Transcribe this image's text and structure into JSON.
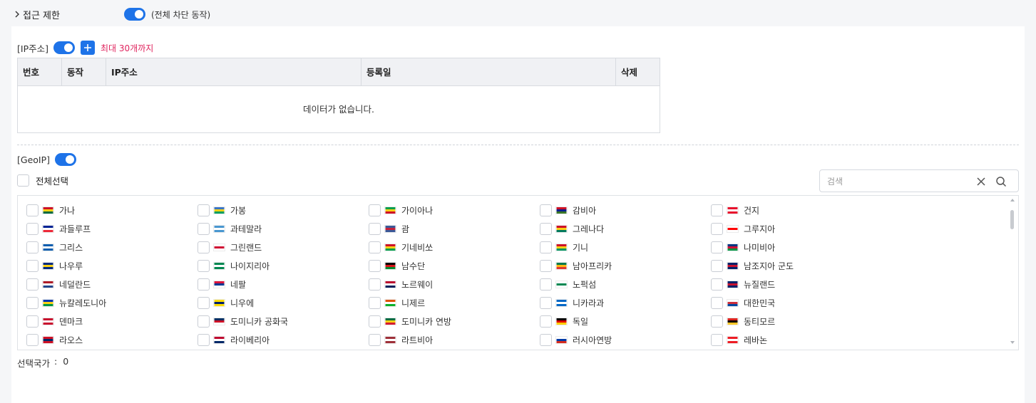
{
  "header": {
    "title": "접근 제한",
    "toggle_on": true,
    "note": "(전체 차단 동작)"
  },
  "ip_section": {
    "label": "[IP주소]",
    "toggle_on": true,
    "add_icon": "plus-icon",
    "limit_text": "최대 30개까지",
    "columns": [
      "번호",
      "동작",
      "IP주소",
      "등록일",
      "삭제"
    ],
    "empty_text": "데이터가 없습니다."
  },
  "geoip_section": {
    "label": "[GeoIP]",
    "toggle_on": true,
    "select_all_label": "전체선택",
    "search_placeholder": "검색",
    "countries": [
      [
        "가나",
        "가봉",
        "가이아나",
        "감비아",
        "건지"
      ],
      [
        "과들루프",
        "과테말라",
        "괌",
        "그레나다",
        "그루지아"
      ],
      [
        "그리스",
        "그린랜드",
        "기네비쏘",
        "기니",
        "나미비아"
      ],
      [
        "나우루",
        "나이지리아",
        "남수단",
        "남아프리카",
        "남조지아 군도"
      ],
      [
        "네덜란드",
        "네팔",
        "노르웨이",
        "노퍽섬",
        "뉴질랜드"
      ],
      [
        "뉴칼레도니아",
        "니우에",
        "니제르",
        "니카라과",
        "대한민국"
      ],
      [
        "덴마크",
        "도미니카 공화국",
        "도미니카 연방",
        "독일",
        "동티모르"
      ],
      [
        "라오스",
        "라이베리아",
        "라트비아",
        "러시아연방",
        "레바논"
      ]
    ],
    "selected_label": "선택국가",
    "selected_sep": ":",
    "selected_count": "0"
  },
  "colors": {
    "accent": "#1e73e8",
    "limit": "#e0245e"
  }
}
